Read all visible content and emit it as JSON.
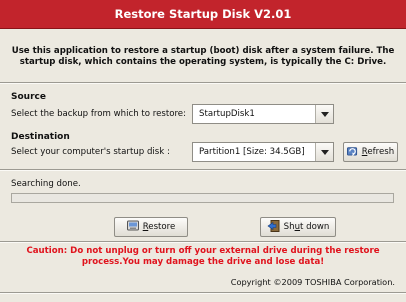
{
  "window": {
    "title": "Restore Startup Disk V2.01"
  },
  "intro": {
    "line1": "Use this application to restore a startup (boot) disk after a system failure. The",
    "line2": "startup disk, which contains the operating system, is typically the C: Drive."
  },
  "source": {
    "title": "Source",
    "label": "Select the backup from which to restore:",
    "selected": "StartupDisk1"
  },
  "destination": {
    "title": "Destination",
    "label": "Select your computer's startup disk :",
    "selected": "Partition1  [Size: 34.5GB]",
    "refresh_label_accel": "R",
    "refresh_label_rest": "efresh"
  },
  "status": {
    "text": "Searching done.",
    "progress": 0
  },
  "actions": {
    "restore_accel": "R",
    "restore_rest": "estore",
    "shutdown_pre": "Sh",
    "shutdown_accel": "u",
    "shutdown_post": "t down"
  },
  "caution": {
    "line1": "Caution: Do not unplug or turn off your external drive during the restore",
    "line2": "process.You may damage the drive and lose data!"
  },
  "footer": {
    "copyright": "Copyright ©2009 TOSHIBA Corporation."
  },
  "colors": {
    "title_bar": "#c2242c",
    "caution": "#e0131d",
    "background": "#ece9e0"
  }
}
